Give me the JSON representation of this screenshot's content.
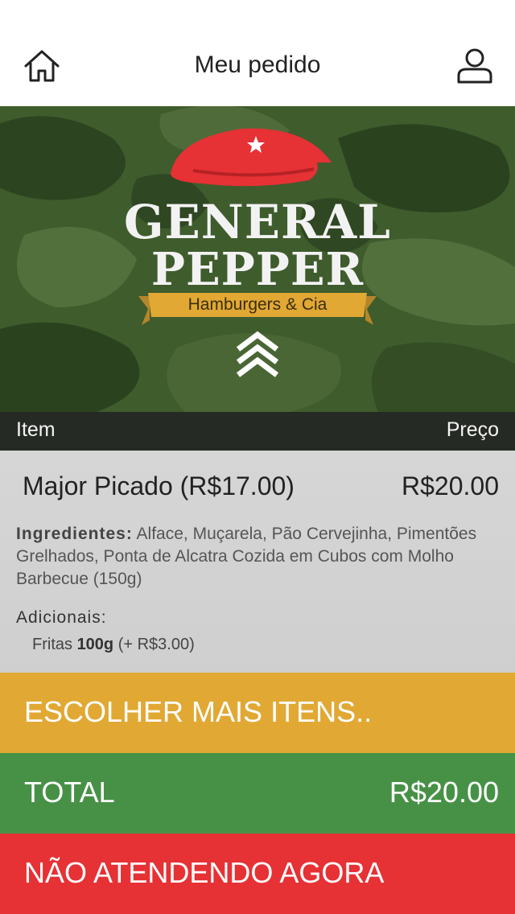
{
  "header": {
    "title": "Meu pedido",
    "home_icon": "home-icon",
    "user_icon": "user-icon"
  },
  "brand": {
    "line1": "GENERAL",
    "line2": "PEPPER",
    "tagline": "Hamburgers & Cia"
  },
  "columns": {
    "item": "Item",
    "price": "Preço"
  },
  "order_item": {
    "name": "Major Picado (R$17.00)",
    "price": "R$20.00",
    "ingredients_label": "Ingredientes:",
    "ingredients": "Alface, Muçarela, Pão Cervejinha, Pimentões Grelhados, Ponta de Alcatra Cozida em Cubos com Molho Barbecue (150g)",
    "additions_label": "Adicionais:",
    "addition_name": "Fritas",
    "addition_qty": "100g",
    "addition_price": "(+ R$3.00)"
  },
  "actions": {
    "more_items": "ESCOLHER MAIS ITENS..",
    "total_label": "TOTAL",
    "total_value": "R$20.00",
    "status": "NÃO ATENDENDO AGORA"
  },
  "colors": {
    "more_items_bg": "#e1a834",
    "total_bg": "#479146",
    "status_bg": "#e63135",
    "beret_red": "#e63135"
  }
}
